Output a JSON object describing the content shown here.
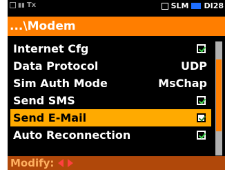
{
  "status_bar": {
    "left_text": "Tx",
    "mode": "SLM",
    "time": "DI28"
  },
  "title": "...\\Modem",
  "items": [
    {
      "label": "Internet Cfg",
      "type": "checkbox",
      "checked": true
    },
    {
      "label": "Data Protocol",
      "type": "value",
      "value": "UDP"
    },
    {
      "label": "Sim Auth Mode",
      "type": "value",
      "value": "MsChap"
    },
    {
      "label": "Send SMS",
      "type": "checkbox",
      "checked": true
    },
    {
      "label": "Send E-Mail",
      "type": "checkbox",
      "checked": true,
      "selected": true
    },
    {
      "label": "Auto Reconnection",
      "type": "checkbox",
      "checked": true
    }
  ],
  "footer": {
    "label": "Modify:"
  },
  "colors": {
    "accent": "#ff7e00",
    "selection": "#ffaa00",
    "check": "#3cd24a",
    "background": "#000000"
  }
}
